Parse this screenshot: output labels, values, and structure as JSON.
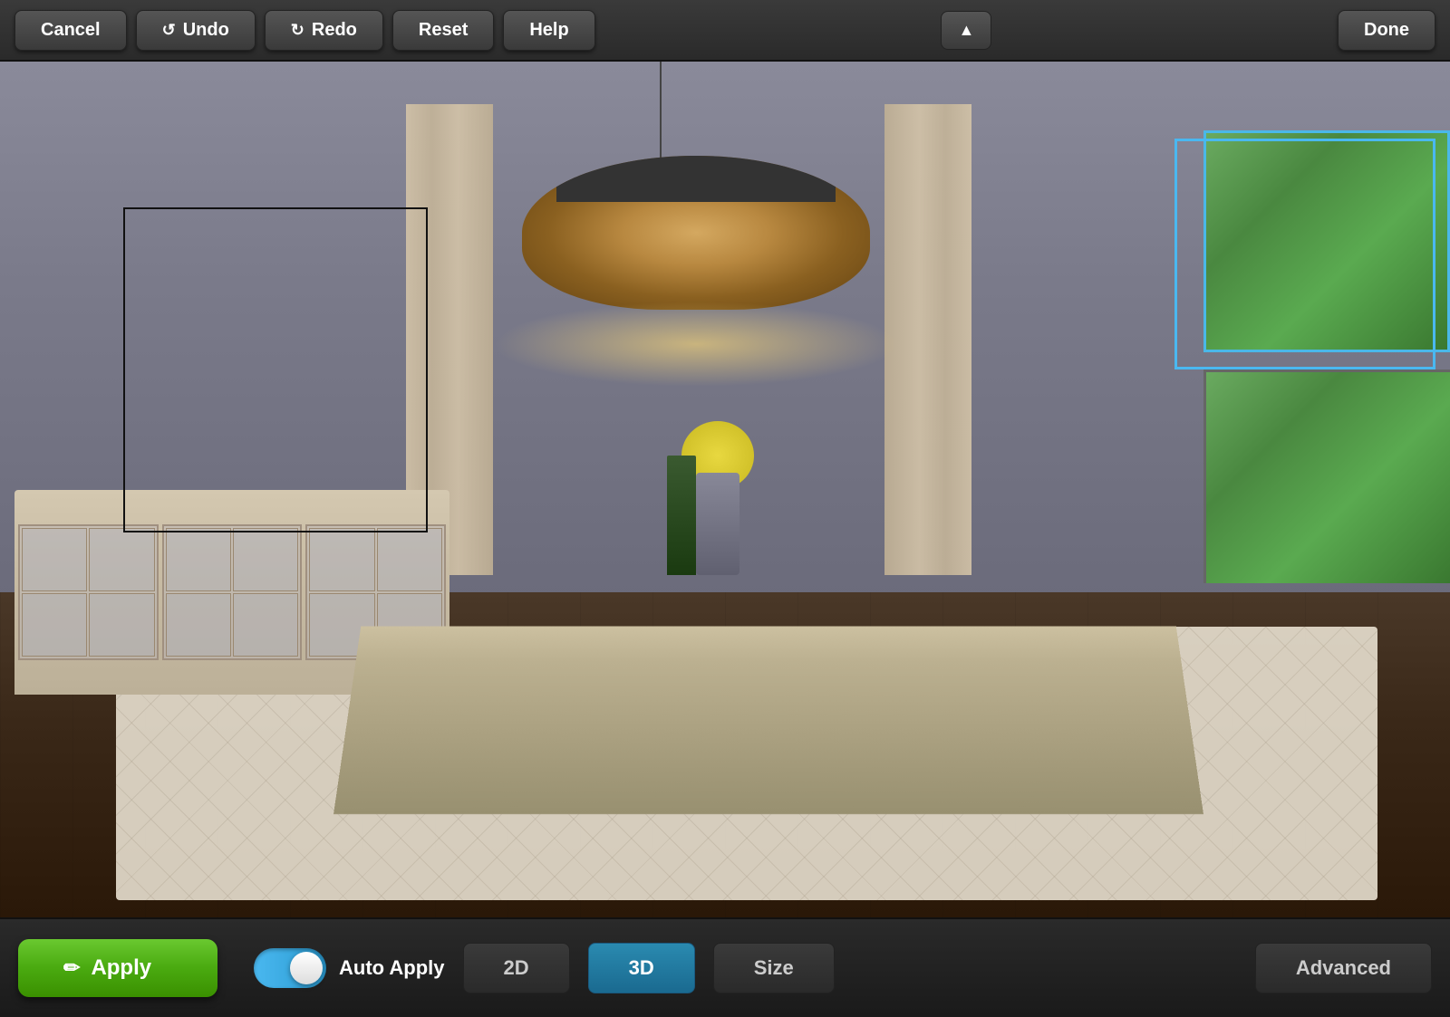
{
  "toolbar": {
    "cancel_label": "Cancel",
    "undo_label": "Undo",
    "redo_label": "Redo",
    "reset_label": "Reset",
    "help_label": "Help",
    "done_label": "Done",
    "collapse_icon": "▲"
  },
  "bottom_toolbar": {
    "apply_label": "Apply",
    "apply_icon": "✏",
    "auto_apply_label": "Auto Apply",
    "view_2d_label": "2D",
    "view_3d_label": "3D",
    "size_label": "Size",
    "advanced_label": "Advanced"
  },
  "scene": {
    "selection_box_left": "black outline box on left wall",
    "selection_box_right": "blue outline box on right wall"
  },
  "colors": {
    "apply_green": "#4aaa10",
    "active_blue": "#1a7aaa",
    "toggle_blue": "#2a9ad0",
    "toolbar_dark": "#2a2a2a",
    "scene_wall": "#8a8a9a"
  }
}
